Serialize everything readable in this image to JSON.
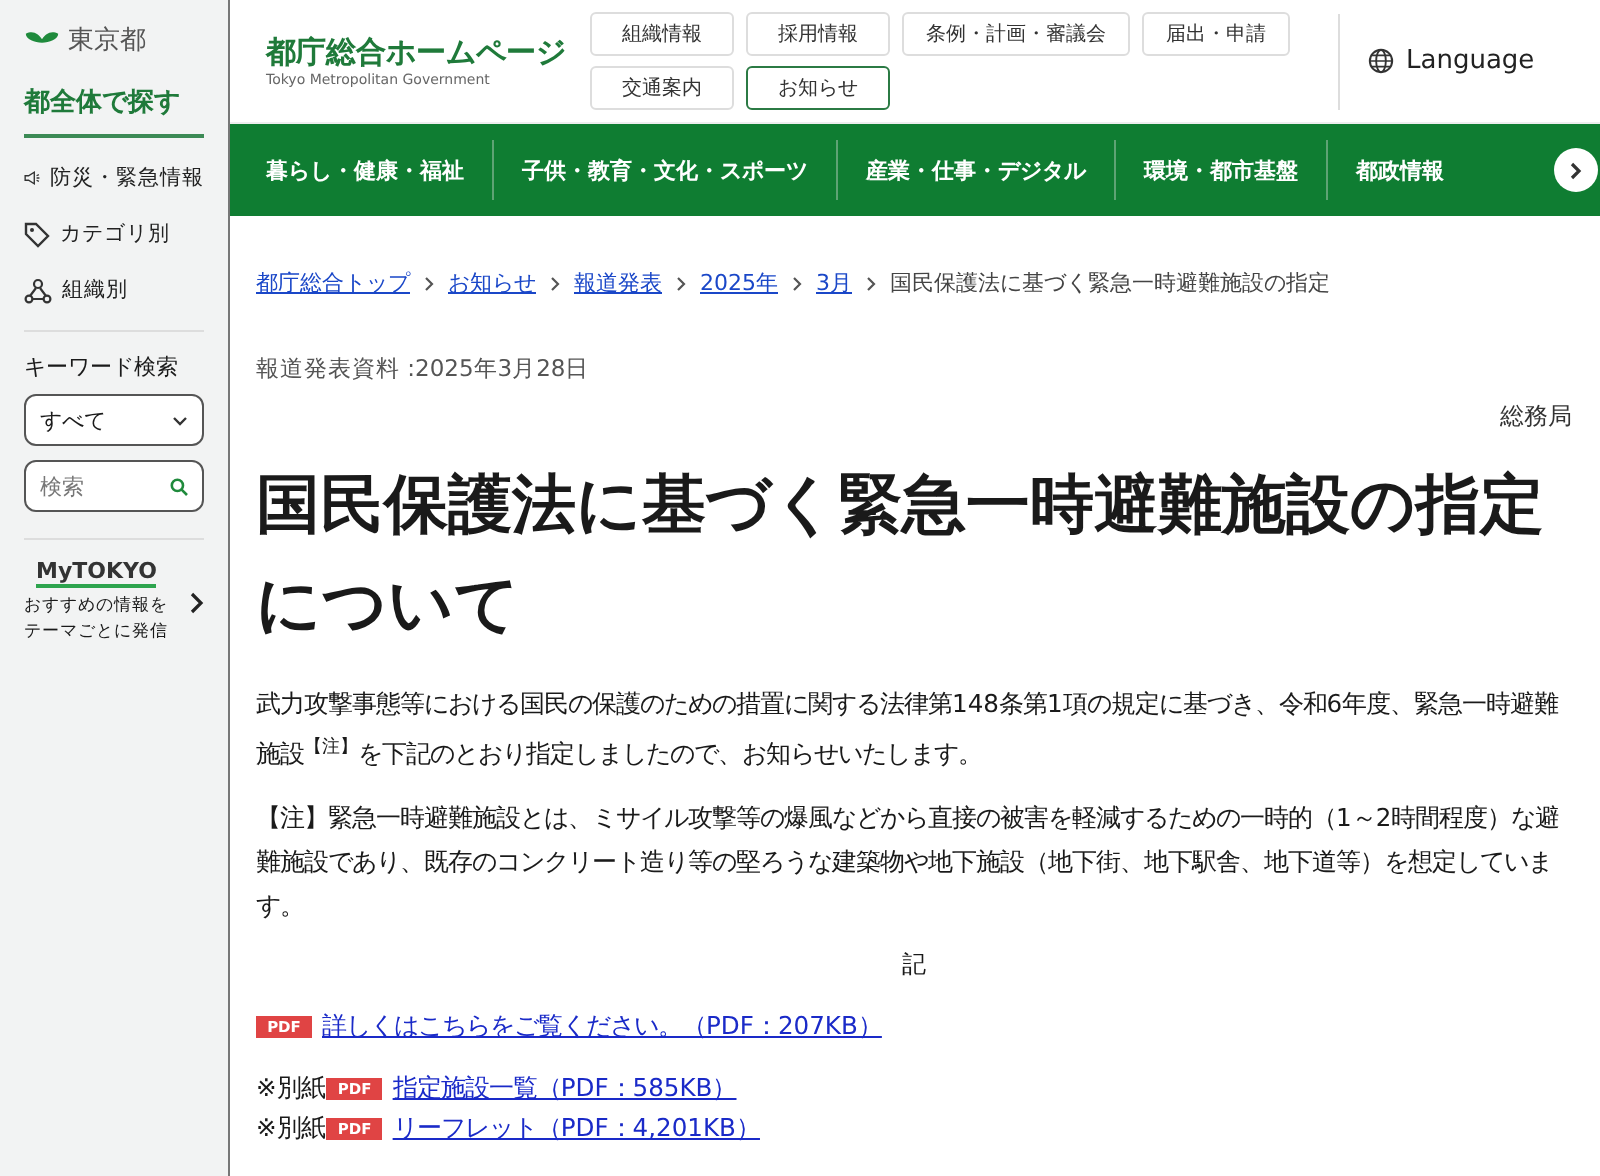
{
  "sidebar": {
    "logo": "東京都",
    "heading": "都全体で探す",
    "items": [
      {
        "kind": "alert",
        "label": "防災・緊急情報"
      },
      {
        "kind": "tag",
        "label": "カテゴリ別"
      },
      {
        "kind": "org",
        "label": "組織別"
      }
    ],
    "keyword_search": {
      "label": "キーワード検索",
      "scope": "すべて",
      "placeholder": "検索"
    },
    "mytokyo": {
      "logo": "MyTOKYO",
      "lines": [
        "おすすめの情報を",
        "テーマごとに発信"
      ]
    }
  },
  "header": {
    "title": "都庁総合ホームページ",
    "subtitle": "Tokyo Metropolitan Government",
    "links": [
      {
        "label": "組織情報",
        "selected": false
      },
      {
        "label": "採用情報",
        "selected": false
      },
      {
        "label": "条例・計画・審議会",
        "selected": false
      },
      {
        "label": "届出・申請",
        "selected": false
      },
      {
        "label": "交通案内",
        "selected": false
      },
      {
        "label": "お知らせ",
        "selected": true
      }
    ],
    "language": "Language"
  },
  "nav": [
    "暮らし・健康・福祉",
    "子供・教育・文化・スポーツ",
    "産業・仕事・デジタル",
    "環境・都市基盤",
    "都政情報"
  ],
  "breadcrumb": {
    "links": [
      "都庁総合トップ",
      "お知らせ",
      "報道発表",
      "2025年",
      "3月"
    ],
    "current": "国民保護法に基づく緊急一時避難施設の指定"
  },
  "article": {
    "date": "報道発表資料 :2025年3月28日",
    "bureau": "総務局",
    "title": "国民保護法に基づく緊急一時避難施設の指定について",
    "paragraphs": [
      "武力攻撃事態等における国民の保護のための措置に関する法律第148条第1項の規定に基づき、令和6年度、緊急一時避難施設$^{【注】}$を下記のとおり指定しましたので、お知らせいたします。",
      "【注】緊急一時避難施設とは、ミサイル攻撃等の爆風などから直接の被害を軽減するための一時的（1～2時間程度）な避難施設であり、既存のコンクリート造り等の堅ろうな建築物や地下施設（地下街、地下駅舎、地下道等）を想定しています。"
    ],
    "center_mark": "記",
    "main_link": {
      "badge": "PDF",
      "label": "詳しくはこちらをご覧ください。（PDF：207KB）"
    },
    "attachments": [
      {
        "prefix": "※別紙",
        "badge": "PDF",
        "label": "指定施設一覧（PDF：585KB）"
      },
      {
        "prefix": "※別紙",
        "badge": "PDF",
        "label": "リーフレット（PDF：4,201KB）"
      }
    ]
  }
}
